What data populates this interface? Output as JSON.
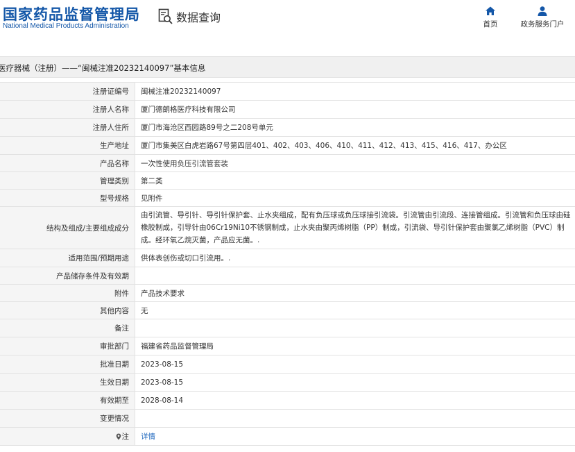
{
  "header": {
    "logo_cn": "国家药品监督管理局",
    "logo_en": "National Medical Products Administration",
    "query_label": "数据查询",
    "nav_home": "首页",
    "nav_gov": "政务服务门户"
  },
  "breadcrumb": "医疗器械（注册）——“闽械注准20232140097”基本信息",
  "rows": [
    {
      "label": "注册证编号",
      "value": "闽械注准20232140097"
    },
    {
      "label": "注册人名称",
      "value": "厦门德朗格医疗科技有限公司"
    },
    {
      "label": "注册人住所",
      "value": "厦门市海沧区西园路89号之二208号单元"
    },
    {
      "label": "生产地址",
      "value": "厦门市集美区白虎岩路67号第四层401、402、403、406、410、411、412、413、415、416、417、办公区"
    },
    {
      "label": "产品名称",
      "value": "一次性使用负压引流管套装"
    },
    {
      "label": "管理类别",
      "value": "第二类"
    },
    {
      "label": "型号规格",
      "value": "见附件"
    },
    {
      "label": "结构及组成/主要组成成分",
      "value": "由引流管、导引针、导引针保护套、止水夹组成，配有负压球或负压球接引流袋。引流管由引流段、连接管组成。引流管和负压球由硅橡胶制成，引导针由06Cr19Ni10不锈钢制成，止水夹由聚丙烯树脂（PP）制成，引流袋、导引针保护套由聚氯乙烯树脂（PVC）制成。经环氧乙烷灭菌，产品应无菌。."
    },
    {
      "label": "适用范围/预期用途",
      "value": "供体表创伤或切口引流用。."
    },
    {
      "label": "产品储存条件及有效期",
      "value": ""
    },
    {
      "label": "附件",
      "value": "产品技术要求"
    },
    {
      "label": "其他内容",
      "value": "无"
    },
    {
      "label": "备注",
      "value": ""
    },
    {
      "label": "审批部门",
      "value": "福建省药品监督管理局"
    },
    {
      "label": "批准日期",
      "value": "2023-08-15"
    },
    {
      "label": "生效日期",
      "value": "2023-08-15"
    },
    {
      "label": "有效期至",
      "value": "2028-08-14"
    },
    {
      "label": "变更情况",
      "value": ""
    },
    {
      "label": "注",
      "value": "详情"
    }
  ],
  "colors": {
    "brand_blue": "#1457a8",
    "link_blue": "#2a6fc1",
    "label_bg": "#f5f5f5",
    "border": "#e2e2e2"
  },
  "icons": {
    "query": "search-document-icon",
    "home": "home-icon",
    "gov": "user-icon",
    "note": "map-pin-icon"
  }
}
